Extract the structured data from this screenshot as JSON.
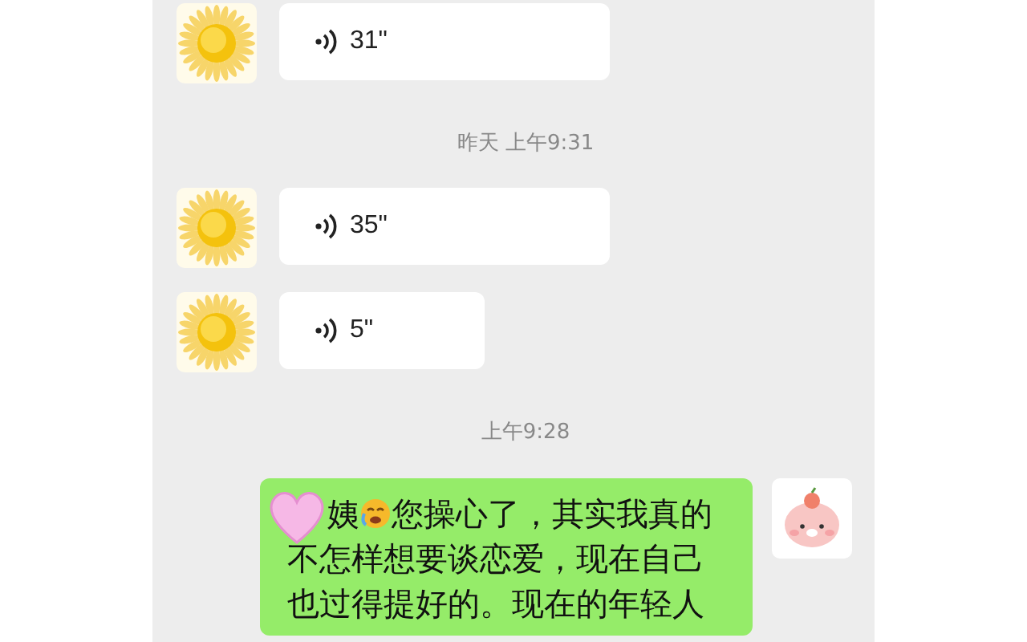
{
  "messages": [
    {
      "kind": "voice",
      "outgoing": false,
      "duration": "31\""
    },
    {
      "kind": "time",
      "text": "昨天 上午9:31"
    },
    {
      "kind": "voice",
      "outgoing": false,
      "duration": "35\""
    },
    {
      "kind": "voice",
      "outgoing": false,
      "duration": "5\""
    },
    {
      "kind": "time",
      "text": "上午9:28"
    },
    {
      "kind": "text",
      "outgoing": true,
      "lines": [
        [
          {
            "kind": "text",
            "text": "姨"
          },
          {
            "kind": "emoji"
          },
          {
            "kind": "text",
            "text": "您操心了，其实我真的"
          }
        ],
        [
          {
            "kind": "text",
            "text": "不怎样想要谈恋爱，现在自己也过得提好的。现在的年轻人"
          }
        ]
      ]
    }
  ]
}
